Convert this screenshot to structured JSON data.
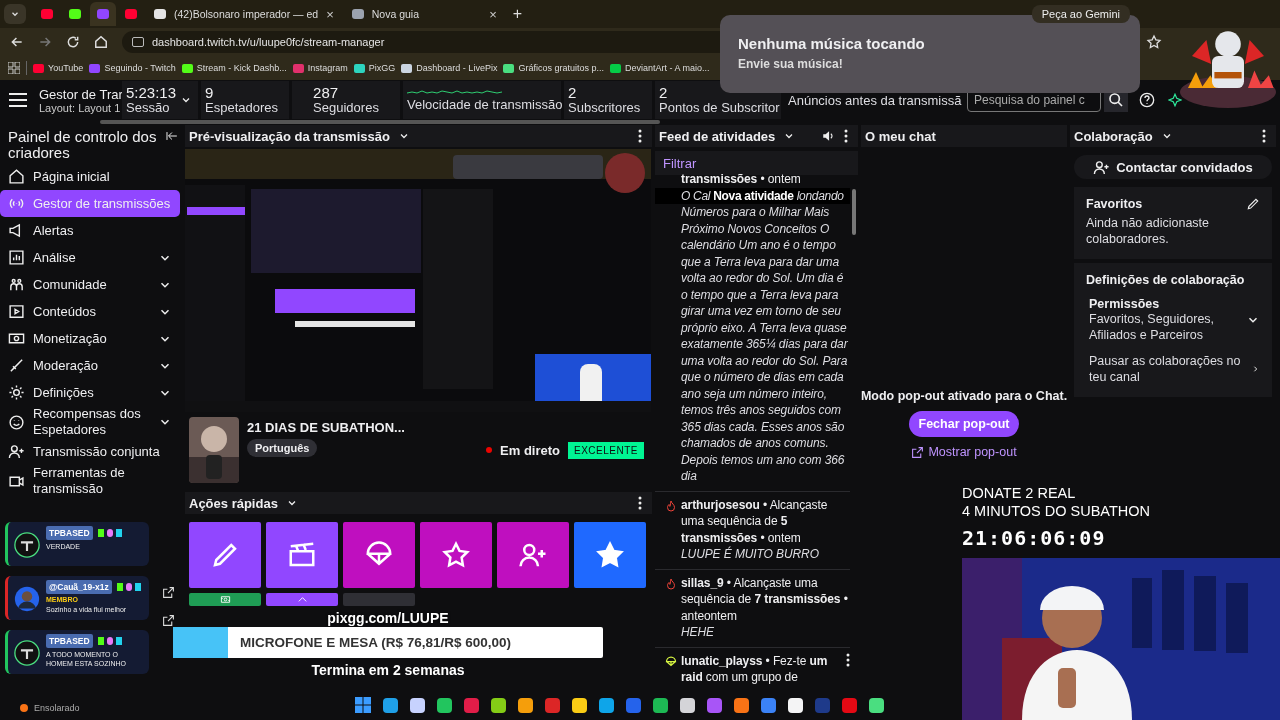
{
  "browser": {
    "tabs": [
      {
        "color": "#ff0033",
        "selected": false
      },
      {
        "color": "#53fc18",
        "selected": false
      },
      {
        "color": "#9146ff",
        "selected": true
      },
      {
        "color": "#ff0033",
        "selected": false
      },
      {
        "color": "#e5e5e5",
        "selected": false,
        "title": "(42)Bolsonaro imperador — ed",
        "close": "×"
      },
      {
        "color": "#9ca3af",
        "selected": false,
        "title": "Nova guia",
        "close": "×"
      }
    ],
    "new_tab": "+",
    "gemini": "Peça ao Gemini",
    "url": "dashboard.twitch.tv/u/luupe0fc/stream-manager",
    "bookmarks": [
      {
        "label": "YouTube",
        "color": "#ff0033"
      },
      {
        "label": "Seguindo - Twitch",
        "color": "#9146ff"
      },
      {
        "label": "Stream - Kick Dashb...",
        "color": "#53fc18"
      },
      {
        "label": "Instagram",
        "color": "#e1306c"
      },
      {
        "label": "PixGG",
        "color": "#2dd4bf"
      },
      {
        "label": "Dashboard - LivePix",
        "color": "#cbd5e1"
      },
      {
        "label": "Gráficos gratuitos p...",
        "color": "#4ade80"
      },
      {
        "label": "DeviantArt - A maio...",
        "color": "#05cc47"
      }
    ]
  },
  "notification": {
    "title": "Nenhuma música tocando",
    "subtitle": "Envie sua música!"
  },
  "header": {
    "title": "Gestor de Trar",
    "layout": "Layout: Layout 1",
    "stats": [
      {
        "value": "5:23:13",
        "label": "Sessão",
        "kind": "session"
      },
      {
        "value": "9",
        "label": "Espetadores",
        "kind": "stat"
      },
      {
        "value": "287",
        "label": "Seguidores",
        "kind": "stat"
      },
      {
        "label": "Velocidade de transmissão",
        "kind": "bitrate"
      },
      {
        "value": "2",
        "label": "Subscritores",
        "kind": "stat"
      },
      {
        "value": "2",
        "label": "Pontos de Subscritor",
        "kind": "stat"
      },
      {
        "label": "Anúncios antes da transmissã",
        "kind": "plain"
      }
    ],
    "search": {
      "placeholder": "Pesquisa do painel c"
    }
  },
  "sidebar": {
    "title": "Painel de controlo dos criadores",
    "items": [
      {
        "label": "Página inicial",
        "kind": "home",
        "expandable": false,
        "selected": false
      },
      {
        "label": "Gestor de transmissões",
        "kind": "broadcast",
        "expandable": false,
        "selected": true
      },
      {
        "label": "Alertas",
        "kind": "megaphone",
        "expandable": false,
        "selected": false
      },
      {
        "label": "Análise",
        "kind": "chart",
        "expandable": true,
        "selected": false
      },
      {
        "label": "Comunidade",
        "kind": "community",
        "expandable": true,
        "selected": false
      },
      {
        "label": "Conteúdos",
        "kind": "film",
        "expandable": true,
        "selected": false
      },
      {
        "label": "Monetização",
        "kind": "money",
        "expandable": true,
        "selected": false
      },
      {
        "label": "Moderação",
        "kind": "sword",
        "expandable": true,
        "selected": false
      },
      {
        "label": "Definições",
        "kind": "gear",
        "expandable": true,
        "selected": false
      },
      {
        "label": "Recompensas dos Espetadores",
        "kind": "smile",
        "expandable": true,
        "selected": false
      },
      {
        "label": "Transmissão conjunta",
        "kind": "adduser",
        "expandable": false,
        "selected": false
      },
      {
        "label": "Ferramentas de transmissão",
        "kind": "camera",
        "expandable": false,
        "selected": false
      }
    ]
  },
  "preview": {
    "title": "Pré-visualização da transmissão",
    "stream_title": "21 DIAS DE SUBATHON...",
    "tag": "Português",
    "status": "Em direto",
    "quality": "EXCELENTE"
  },
  "quick_actions": {
    "title": "Ações rápidas",
    "tiles": [
      {
        "kind": "pencil",
        "color": "#9147ff"
      },
      {
        "kind": "clapper",
        "color": "#9147ff"
      },
      {
        "kind": "parachute",
        "color": "#bf0fbf"
      },
      {
        "kind": "star",
        "color": "#bf0fbf"
      },
      {
        "kind": "adduser",
        "color": "#bf0fbf"
      },
      {
        "kind": "starfill",
        "color": "#1f69ff"
      },
      {
        "kind": "cash",
        "color": "#1f9d55"
      },
      {
        "kind": "roof",
        "color": "#9147ff"
      },
      {
        "kind": "blank",
        "color": "#2f2f35"
      }
    ]
  },
  "activity_feed": {
    "title": "Feed de atividades",
    "filter": "Filtrar",
    "tooltip": "Nova atividade",
    "items": [
      {
        "kind": "cut",
        "text": "**transmissões** • ontem",
        "lead": "O Cal",
        "tail": "londando",
        "message": "Números para o Milhar Mais Próximo Novos Conceitos O calendário Um ano é o tempo que a Terra leva para dar uma volta ao redor do Sol. Um dia é o tempo que a Terra leva para girar uma vez em torno de seu próprio eixo. A Terra leva quase exatamente 365¼ dias para dar uma volta ao redor do Sol. Para que o número de dias em cada ano seja um número inteiro, temos três anos seguidos com 365 dias cada. Esses anos são chamados de anos comuns. Depois temos um ano com 366 dia"
      },
      {
        "kind": "streak",
        "text": "**arthurjosesou** • Alcançaste uma sequência de **5 transmissões** • ontem",
        "message": "LUUPE É MUITO BURRO"
      },
      {
        "kind": "streak",
        "text": "**sillas_9** • Alcançaste uma sequência de **7 transmissões** • anteontem",
        "message": "HEHE"
      },
      {
        "kind": "raid",
        "text": "**lunatic_playss** • Fez-te **um raid** com um grupo de"
      }
    ]
  },
  "chat": {
    "title": "O meu chat",
    "notice": "Modo pop-out ativado para o Chat.",
    "close_button": "Fechar pop-out",
    "show_link": "Mostrar pop-out"
  },
  "collaboration": {
    "title": "Colaboração",
    "contact_button": "Contactar convidados",
    "favorites": {
      "title": "Favoritos",
      "empty": "Ainda não adicionaste colaboradores."
    },
    "settings": {
      "title": "Definições de colaboração",
      "permissions_label": "Permissões",
      "permissions_value": "Favoritos, Seguidores, Afiliados e Parceiros",
      "pause": "Pausar as colaborações no teu canal"
    }
  },
  "alerts": [
    {
      "user": "TPBASED",
      "message": "VERDADE",
      "color": "#22c55e",
      "kind": "logo"
    },
    {
      "user": "@Cauã_19-x1z",
      "badge": "MEMBRO",
      "message": "Sozinho a vida flui melhor",
      "color": "#dc2626"
    },
    {
      "user": "TPBASED",
      "message": "A TODO MOMENTO O HOMEM ESTA SOZINHO",
      "color": "#22c55e",
      "kind": "logo"
    }
  ],
  "weather": "Ensolarado",
  "goal": {
    "link": "pixgg.com/LUUPE",
    "label": "MICROFONE E MESA (R$ 76,81/R$ 600,00)",
    "level": 0.128,
    "ends": "Termina em 2 semanas"
  },
  "donate": {
    "line_1": "DONATE 2 REAL",
    "line_2": "4 MINUTOS DO SUBATHON",
    "timer": "21:06:06:09"
  },
  "taskbar": {
    "apps": [
      {
        "color": "#3b9cff"
      },
      {
        "color": "#1fa0e8"
      },
      {
        "color": "#c7d2fe"
      },
      {
        "color": "#22c55e"
      },
      {
        "color": "#e11d48"
      },
      {
        "color": "#84cc16"
      },
      {
        "color": "#f59e0b"
      },
      {
        "color": "#dc2626"
      },
      {
        "color": "#facc15"
      },
      {
        "color": "#0ea5e9"
      },
      {
        "color": "#2563eb"
      },
      {
        "color": "#1db954"
      },
      {
        "color": "#d4d4d8"
      },
      {
        "color": "#a855f7"
      },
      {
        "color": "#f97316"
      },
      {
        "color": "#3b82f6"
      },
      {
        "color": "#f4f4f5"
      },
      {
        "color": "#1e3a8a"
      },
      {
        "color": "#e50914"
      },
      {
        "color": "#4ade80"
      }
    ]
  }
}
